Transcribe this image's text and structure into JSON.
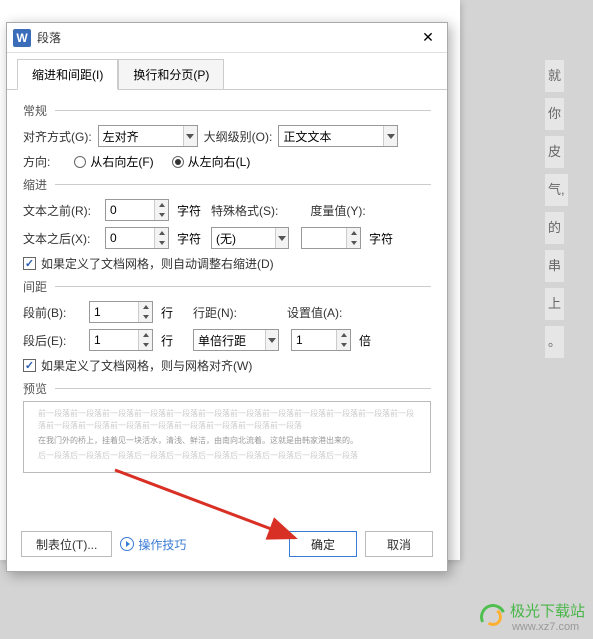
{
  "dialog": {
    "title": "段落",
    "app_letter": "W",
    "tabs": {
      "indent": "缩进和间距(I)",
      "line": "换行和分页(P)"
    },
    "sections": {
      "general": "常规",
      "indent": "缩进",
      "spacing": "间距",
      "preview": "预览"
    },
    "general": {
      "align_label": "对齐方式(G):",
      "align_value": "左对齐",
      "outline_label": "大纲级别(O):",
      "outline_value": "正文文本",
      "direction_label": "方向:",
      "rtl_label": "从右向左(F)",
      "ltr_label": "从左向右(L)"
    },
    "indent": {
      "before_label": "文本之前(R):",
      "before_value": "0",
      "after_label": "文本之后(X):",
      "after_value": "0",
      "unit_char": "字符",
      "special_label": "特殊格式(S):",
      "special_value": "(无)",
      "metric_label": "度量值(Y):",
      "metric_value": "",
      "checkbox": "如果定义了文档网格，则自动调整右缩进(D)"
    },
    "spacing": {
      "before_label": "段前(B):",
      "before_value": "1",
      "after_label": "段后(E):",
      "after_value": "1",
      "unit_line": "行",
      "linespacing_label": "行距(N):",
      "linespacing_value": "单倍行距",
      "setvalue_label": "设置值(A):",
      "setvalue_value": "1",
      "unit_times": "倍",
      "checkbox": "如果定义了文档网格，则与网格对齐(W)"
    },
    "preview": {
      "faded": "前一段落前一段落前一段落前一段落前一段落前一段落前一段落前一段落前一段落前一段落前一段落前一段落前一段落前一段落前一段落前一段落前一段落前一段落前一段落前一段落",
      "main": "在我门外的桥上，挂着见一块活水，清浅、鲜洁，由南向北流着。这就是由韩家港出来的。",
      "faded2": "后一段落后一段落后一段落后一段落后一段落后一段落后一段落后一段落后一段落后一段落"
    },
    "footer": {
      "tabstop": "制表位(T)...",
      "tips": "操作技巧",
      "ok": "确定",
      "cancel": "取消"
    }
  },
  "doc_fragments": [
    "就",
    "你",
    "皮",
    "气,",
    "的",
    "串",
    "上",
    "。"
  ],
  "watermark": {
    "name": "极光下载站",
    "url": "www.xz7.com"
  }
}
